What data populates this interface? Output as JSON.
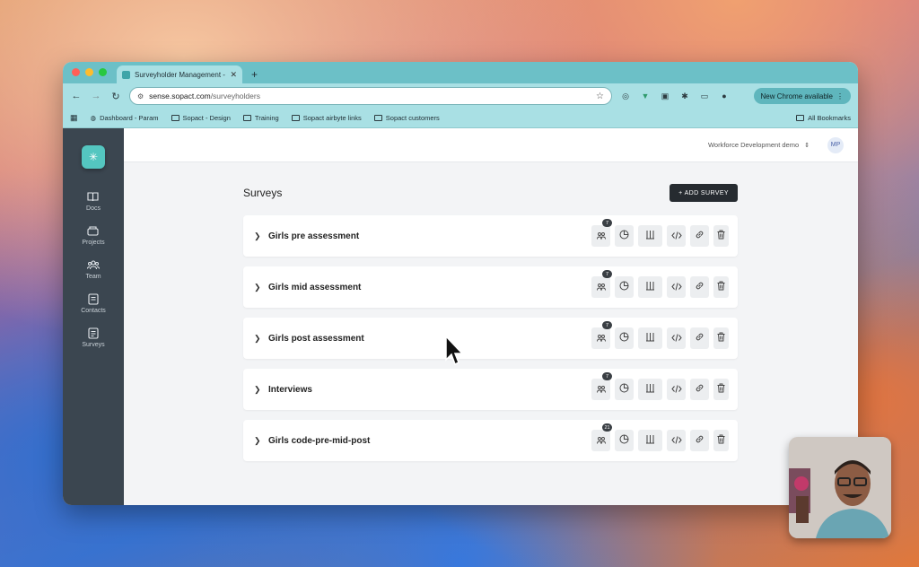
{
  "browser": {
    "tab_title": "Surveyholder Management -",
    "url_host": "sense.sopact.com",
    "url_path": "/surveyholders",
    "update_label": "New Chrome available",
    "bookmarks": [
      {
        "label": "Dashboard - Param",
        "icon": "globe-icon"
      },
      {
        "label": "Sopact - Design",
        "icon": "folder-icon"
      },
      {
        "label": "Training",
        "icon": "folder-icon"
      },
      {
        "label": "Sopact airbyte links",
        "icon": "folder-icon"
      },
      {
        "label": "Sopact customers",
        "icon": "folder-icon"
      }
    ],
    "all_bookmarks": "All Bookmarks"
  },
  "sidebar": {
    "items": [
      {
        "label": "Docs",
        "icon": "book-icon"
      },
      {
        "label": "Projects",
        "icon": "box-icon"
      },
      {
        "label": "Team",
        "icon": "team-icon"
      },
      {
        "label": "Contacts",
        "icon": "contacts-icon"
      },
      {
        "label": "Surveys",
        "icon": "surveys-icon"
      }
    ]
  },
  "header": {
    "org": "Workforce Development demo",
    "user_initials": "MP"
  },
  "main": {
    "title": "Surveys",
    "add_button": "+ ADD SURVEY",
    "surveys": [
      {
        "name": "Girls pre assessment",
        "count": "7"
      },
      {
        "name": "Girls mid assessment",
        "count": "7"
      },
      {
        "name": "Girls post assessment",
        "count": "7"
      },
      {
        "name": "Interviews",
        "count": "7"
      },
      {
        "name": "Girls code-pre-mid-post",
        "count": "21"
      }
    ]
  },
  "colors": {
    "tabbar": "#6cc0c7",
    "toolbar": "#a9e0e4",
    "sidebar": "#3b4650",
    "accent": "#54c6c0",
    "button": "#262b30"
  }
}
